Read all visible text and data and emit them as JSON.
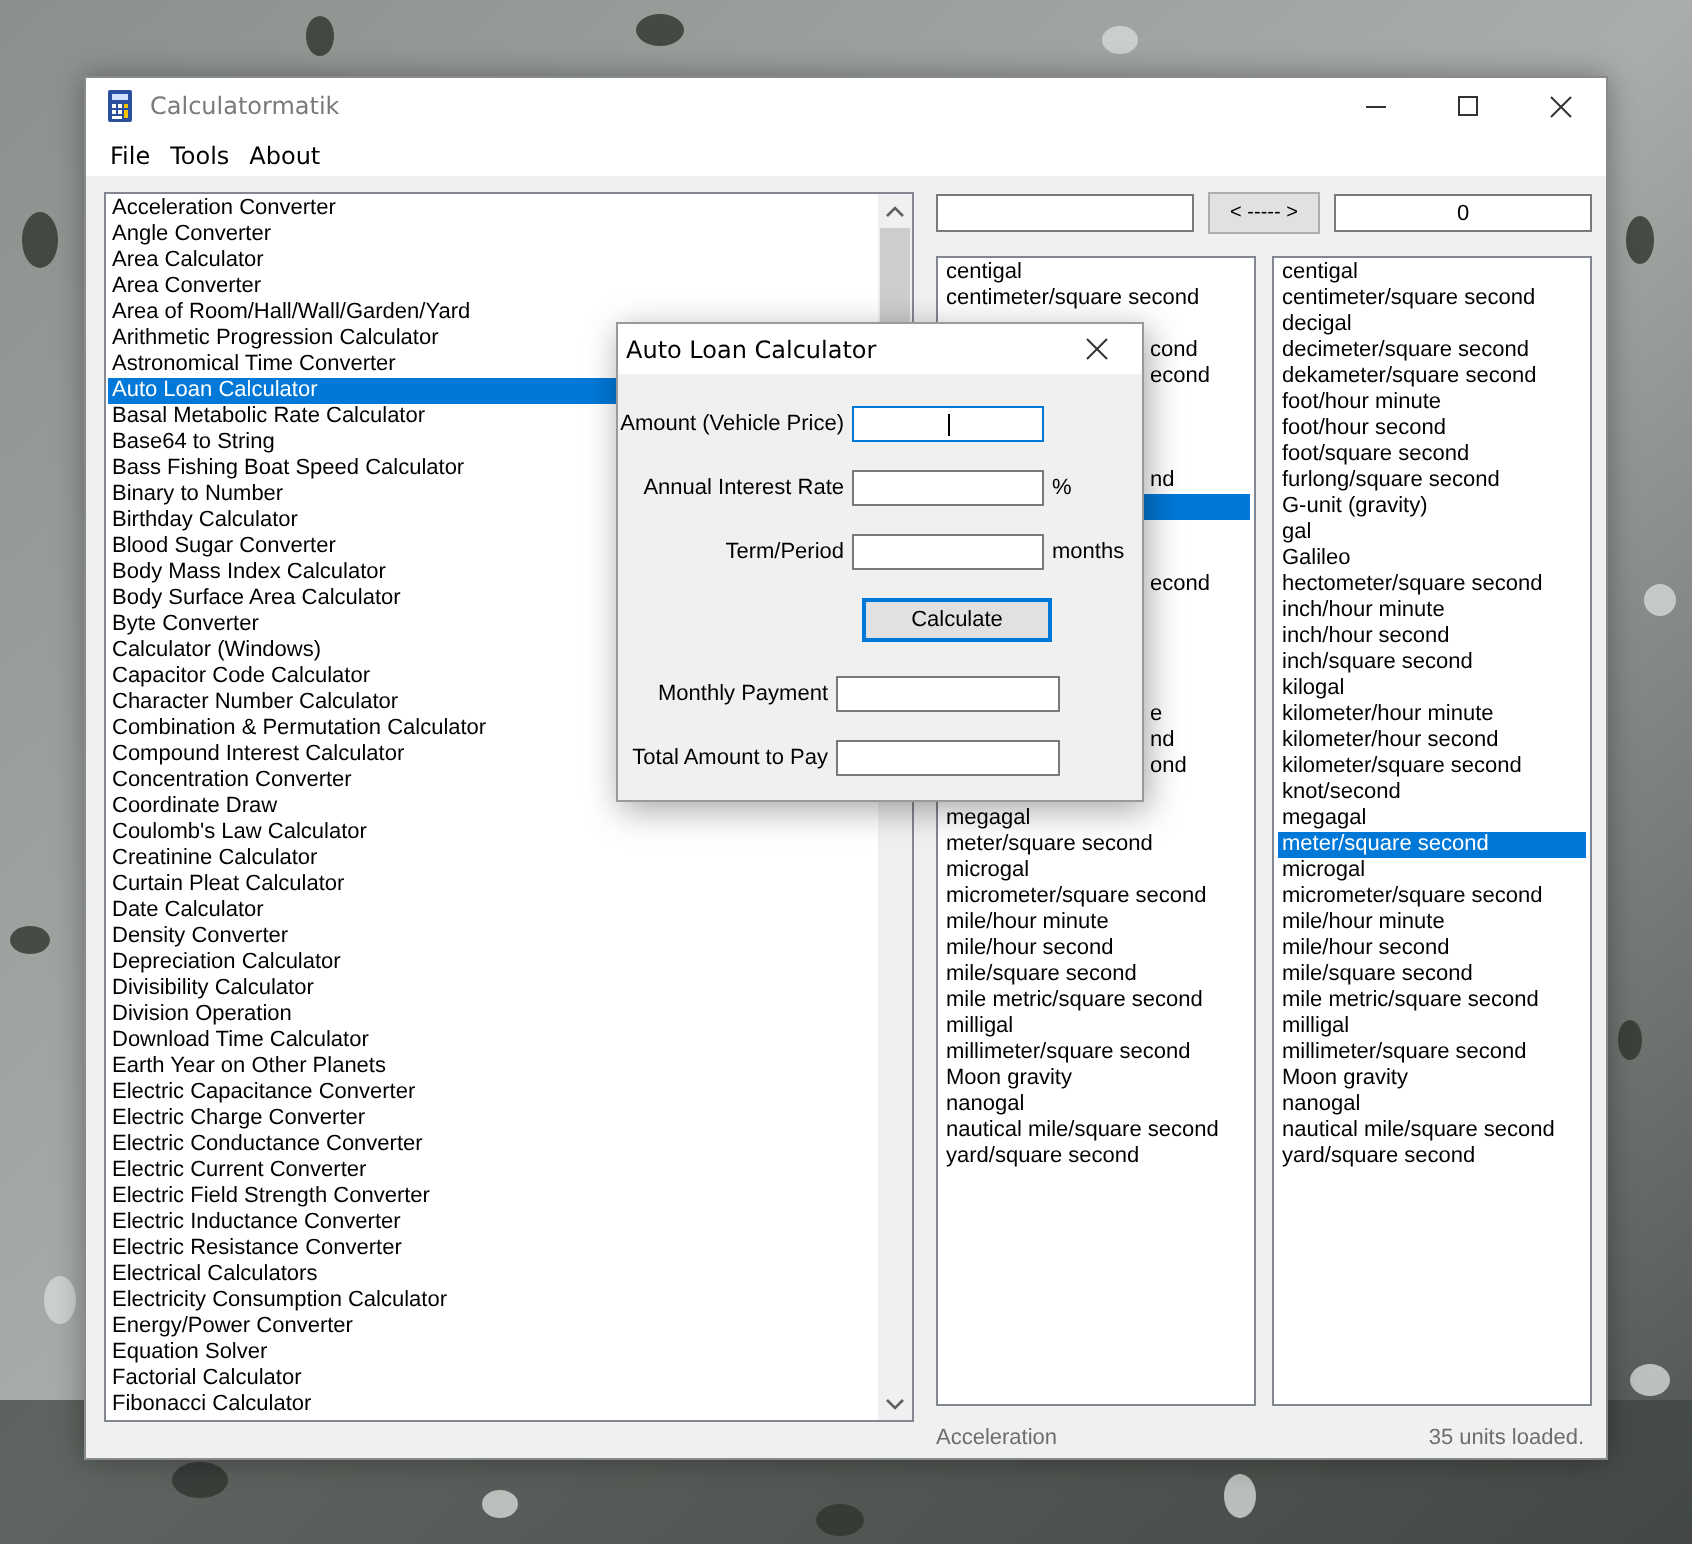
{
  "window": {
    "title": "Calculatormatik"
  },
  "menu": [
    {
      "label": "File"
    },
    {
      "label": "Tools"
    },
    {
      "label": "About"
    }
  ],
  "calculators": [
    {
      "label": "Acceleration Converter",
      "selected": false
    },
    {
      "label": "Angle Converter",
      "selected": false
    },
    {
      "label": "Area Calculator",
      "selected": false
    },
    {
      "label": "Area Converter",
      "selected": false
    },
    {
      "label": "Area of Room/Hall/Wall/Garden/Yard",
      "selected": false
    },
    {
      "label": "Arithmetic Progression Calculator",
      "selected": false
    },
    {
      "label": "Astronomical Time Converter",
      "selected": false
    },
    {
      "label": "Auto Loan Calculator",
      "selected": true
    },
    {
      "label": "Basal Metabolic Rate Calculator",
      "selected": false
    },
    {
      "label": "Base64 to String",
      "selected": false
    },
    {
      "label": "Bass Fishing Boat Speed Calculator",
      "selected": false
    },
    {
      "label": "Binary to Number",
      "selected": false
    },
    {
      "label": "Birthday Calculator",
      "selected": false
    },
    {
      "label": "Blood Sugar Converter",
      "selected": false
    },
    {
      "label": "Body Mass Index Calculator",
      "selected": false
    },
    {
      "label": "Body Surface Area Calculator",
      "selected": false
    },
    {
      "label": "Byte Converter",
      "selected": false
    },
    {
      "label": "Calculator (Windows)",
      "selected": false
    },
    {
      "label": "Capacitor Code Calculator",
      "selected": false
    },
    {
      "label": "Character Number Calculator",
      "selected": false
    },
    {
      "label": "Combination & Permutation Calculator",
      "selected": false
    },
    {
      "label": "Compound Interest Calculator",
      "selected": false
    },
    {
      "label": "Concentration Converter",
      "selected": false
    },
    {
      "label": "Coordinate Draw",
      "selected": false
    },
    {
      "label": "Coulomb's Law Calculator",
      "selected": false
    },
    {
      "label": "Creatinine Calculator",
      "selected": false
    },
    {
      "label": "Curtain Pleat Calculator",
      "selected": false
    },
    {
      "label": "Date Calculator",
      "selected": false
    },
    {
      "label": "Density Converter",
      "selected": false
    },
    {
      "label": "Depreciation Calculator",
      "selected": false
    },
    {
      "label": "Divisibility Calculator",
      "selected": false
    },
    {
      "label": "Division Operation",
      "selected": false
    },
    {
      "label": "Download Time Calculator",
      "selected": false
    },
    {
      "label": "Earth Year on Other Planets",
      "selected": false
    },
    {
      "label": "Electric Capacitance Converter",
      "selected": false
    },
    {
      "label": "Electric Charge Converter",
      "selected": false
    },
    {
      "label": "Electric Conductance Converter",
      "selected": false
    },
    {
      "label": "Electric Current Converter",
      "selected": false
    },
    {
      "label": "Electric Field Strength Converter",
      "selected": false
    },
    {
      "label": "Electric Inductance Converter",
      "selected": false
    },
    {
      "label": "Electric Resistance Converter",
      "selected": false
    },
    {
      "label": "Electrical Calculators",
      "selected": false
    },
    {
      "label": "Electricity Consumption Calculator",
      "selected": false
    },
    {
      "label": "Energy/Power Converter",
      "selected": false
    },
    {
      "label": "Equation Solver",
      "selected": false
    },
    {
      "label": "Factorial Calculator",
      "selected": false
    },
    {
      "label": "Fibonacci Calculator",
      "selected": false
    }
  ],
  "converter": {
    "swap_button": "< ----- >",
    "to_value": "0",
    "from_units": [
      {
        "kind": "full",
        "label": "centigal",
        "selected": false
      },
      {
        "kind": "full",
        "label": "centimeter/square second",
        "selected": false
      },
      {
        "kind": "covered"
      },
      {
        "kind": "covered",
        "label": "cond",
        "selected": false
      },
      {
        "kind": "covered",
        "label": "econd",
        "selected": false
      },
      {
        "kind": "covered"
      },
      {
        "kind": "covered"
      },
      {
        "kind": "covered"
      },
      {
        "kind": "covered",
        "label": "nd",
        "selected": false
      },
      {
        "kind": "covered",
        "selected": true
      },
      {
        "kind": "covered"
      },
      {
        "kind": "covered"
      },
      {
        "kind": "covered",
        "label": "econd",
        "selected": false
      },
      {
        "kind": "covered"
      },
      {
        "kind": "covered"
      },
      {
        "kind": "covered"
      },
      {
        "kind": "covered"
      },
      {
        "kind": "covered",
        "label": "e",
        "selected": false
      },
      {
        "kind": "covered",
        "label": "nd",
        "selected": false
      },
      {
        "kind": "covered",
        "label": "ond",
        "selected": false
      },
      {
        "kind": "covered"
      },
      {
        "label": "megagal",
        "selected": false
      },
      {
        "label": "meter/square second",
        "selected": false
      },
      {
        "label": "microgal",
        "selected": false
      },
      {
        "label": "micrometer/square second",
        "selected": false
      },
      {
        "label": "mile/hour minute",
        "selected": false
      },
      {
        "label": "mile/hour second",
        "selected": false
      },
      {
        "label": "mile/square second",
        "selected": false
      },
      {
        "label": "mile metric/square second",
        "selected": false
      },
      {
        "label": "milligal",
        "selected": false
      },
      {
        "label": "millimeter/square second",
        "selected": false
      },
      {
        "label": "Moon gravity",
        "selected": false
      },
      {
        "label": "nanogal",
        "selected": false
      },
      {
        "label": "nautical mile/square second",
        "selected": false
      },
      {
        "label": "yard/square second",
        "selected": false
      }
    ],
    "to_units": [
      {
        "label": "centigal",
        "selected": false
      },
      {
        "label": "centimeter/square second",
        "selected": false
      },
      {
        "label": "decigal",
        "selected": false
      },
      {
        "label": "decimeter/square second",
        "selected": false
      },
      {
        "label": "dekameter/square second",
        "selected": false
      },
      {
        "label": "foot/hour minute",
        "selected": false
      },
      {
        "label": "foot/hour second",
        "selected": false
      },
      {
        "label": "foot/square second",
        "selected": false
      },
      {
        "label": "furlong/square second",
        "selected": false
      },
      {
        "label": "G-unit (gravity)",
        "selected": false
      },
      {
        "label": "gal",
        "selected": false
      },
      {
        "label": "Galileo",
        "selected": false
      },
      {
        "label": "hectometer/square second",
        "selected": false
      },
      {
        "label": "inch/hour minute",
        "selected": false
      },
      {
        "label": "inch/hour second",
        "selected": false
      },
      {
        "label": "inch/square second",
        "selected": false
      },
      {
        "label": "kilogal",
        "selected": false
      },
      {
        "label": "kilometer/hour minute",
        "selected": false
      },
      {
        "label": "kilometer/hour second",
        "selected": false
      },
      {
        "label": "kilometer/square second",
        "selected": false
      },
      {
        "label": "knot/second",
        "selected": false
      },
      {
        "label": "megagal",
        "selected": false
      },
      {
        "label": "meter/square second",
        "selected": true
      },
      {
        "label": "microgal",
        "selected": false
      },
      {
        "label": "micrometer/square second",
        "selected": false
      },
      {
        "label": "mile/hour minute",
        "selected": false
      },
      {
        "label": "mile/hour second",
        "selected": false
      },
      {
        "label": "mile/square second",
        "selected": false
      },
      {
        "label": "mile metric/square second",
        "selected": false
      },
      {
        "label": "milligal",
        "selected": false
      },
      {
        "label": "millimeter/square second",
        "selected": false
      },
      {
        "label": "Moon gravity",
        "selected": false
      },
      {
        "label": "nanogal",
        "selected": false
      },
      {
        "label": "nautical mile/square second",
        "selected": false
      },
      {
        "label": "yard/square second",
        "selected": false
      }
    ]
  },
  "status_bar": {
    "category": "Acceleration",
    "message": "35 units loaded."
  },
  "dialog": {
    "title": "Auto Loan Calculator",
    "fields": [
      {
        "label": "Amount (Vehicle Price)",
        "focused": true
      },
      {
        "label": "Annual Interest Rate",
        "unit": "%",
        "focused": false
      },
      {
        "label": "Term/Period",
        "unit": "months",
        "focused": false
      }
    ],
    "button": "Calculate",
    "results": [
      {
        "label": "Monthly Payment"
      },
      {
        "label": "Total Amount to Pay"
      }
    ]
  }
}
